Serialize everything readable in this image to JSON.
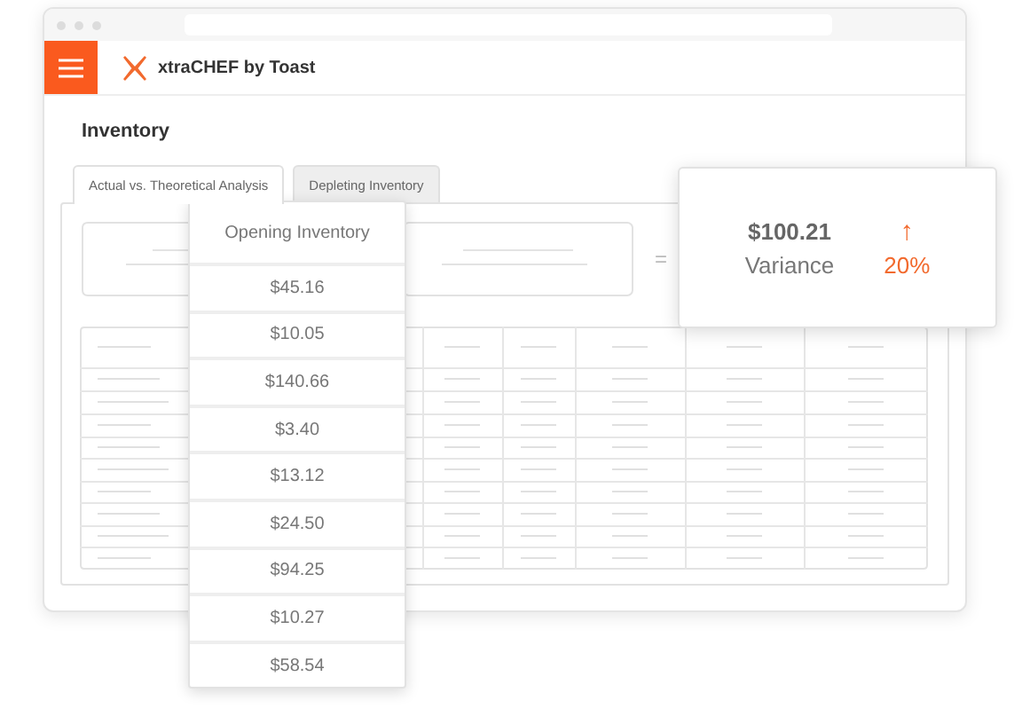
{
  "app": {
    "title": "xtraCHEF by Toast"
  },
  "page": {
    "title": "Inventory"
  },
  "tabs": [
    {
      "label": "Actual vs. Theoretical Analysis",
      "selected": true
    },
    {
      "label": "Depleting Inventory",
      "selected": false
    }
  ],
  "formula": {
    "operator": "="
  },
  "opening_inventory": {
    "heading": "Opening Inventory",
    "values": [
      "$45.16",
      "$10.05",
      "$140.66",
      "$3.40",
      "$13.12",
      "$24.50",
      "$94.25",
      "$10.27",
      "$58.54"
    ]
  },
  "variance": {
    "amount": "$100.21",
    "label": "Variance",
    "arrow": "↑",
    "percent": "20%"
  }
}
